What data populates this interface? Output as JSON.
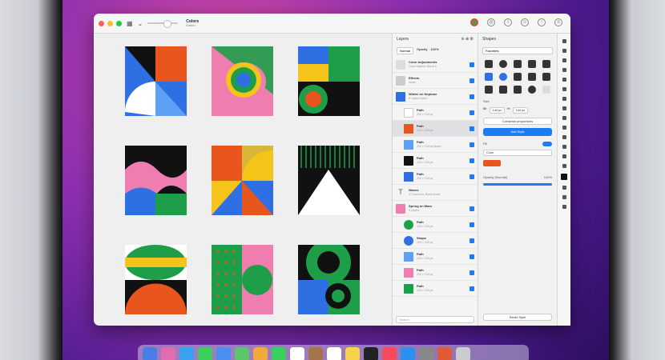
{
  "window": {
    "title": "Colors",
    "subtitle": "Edited"
  },
  "layers_panel": {
    "title": "Layers",
    "blend_mode": "Normal",
    "opacity_label": "Opacity",
    "opacity_value": "100%",
    "rows": [
      {
        "name": "Color Adjustments",
        "sub": "Color Balance",
        "extra": "Black &"
      },
      {
        "name": "Effects",
        "sub": "Noise",
        "extra": ""
      },
      {
        "name": "Winter on Neptune",
        "sub": "6 Layers",
        "extra": "Mask ›"
      },
      {
        "name": "Path",
        "sub": "100 × 100 px",
        "extra": ""
      },
      {
        "name": "Path",
        "sub": "100 × 100 px",
        "extra": ""
      },
      {
        "name": "Path",
        "sub": "100 × 100 px",
        "extra": "Mask ›"
      },
      {
        "name": "Path",
        "sub": "100 × 100 px",
        "extra": ""
      },
      {
        "name": "Path",
        "sub": "100 × 100 px",
        "extra": ""
      },
      {
        "name": "Waves",
        "sub": "37 Contours, Black Mode",
        "extra": ""
      },
      {
        "name": "Spring on Mars",
        "sub": "6 Layers",
        "extra": ""
      },
      {
        "name": "Path",
        "sub": "100 × 100 px",
        "extra": ""
      },
      {
        "name": "Shape",
        "sub": "100 × 100 px",
        "extra": ""
      },
      {
        "name": "Path",
        "sub": "100 × 100 px",
        "extra": ""
      },
      {
        "name": "Path",
        "sub": "100 × 100 px",
        "extra": ""
      },
      {
        "name": "Path",
        "sub": "100 × 100 px",
        "extra": ""
      }
    ],
    "search_placeholder": "Search"
  },
  "shapes_panel": {
    "title": "Shapes",
    "category": "Favorites",
    "size_label": "Size",
    "width_label": "W:",
    "width_value": "144 px",
    "height_label": "H:",
    "height_value": "144 px",
    "constrain_label": "Constrain proportions",
    "add_style": "Add Style",
    "fill_label": "Fill",
    "color_label": "Color",
    "opacity_label": "Opacity (Normal)",
    "opacity_value": "100%",
    "reset_style": "Reset Style"
  },
  "colors": {
    "accent": "#1e7cf2",
    "orange": "#e8561e",
    "green": "#1f9e4a",
    "blue": "#2f6fe4",
    "pink": "#f07db0",
    "yellow": "#f6c31a",
    "black": "#111111"
  }
}
